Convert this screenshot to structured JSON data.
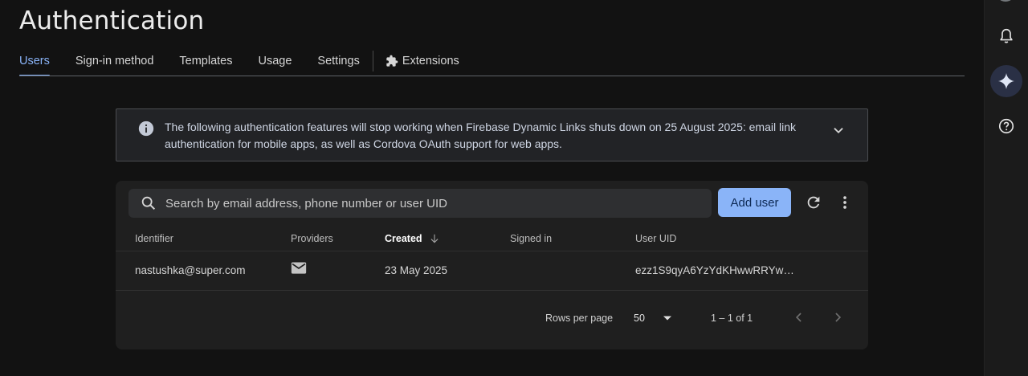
{
  "header": {
    "title": "Authentication"
  },
  "tabs": [
    {
      "label": "Users",
      "active": true
    },
    {
      "label": "Sign-in method"
    },
    {
      "label": "Templates"
    },
    {
      "label": "Usage"
    },
    {
      "label": "Settings"
    },
    {
      "label": "Extensions",
      "icon": "extensions-icon"
    }
  ],
  "banner": {
    "icon": "info-icon",
    "message": "The following authentication features will stop working when Firebase Dynamic Links shuts down on 25 August 2025: email link authentication for mobile apps, as well as Cordova OAuth support for web apps."
  },
  "users_table": {
    "search_placeholder": "Search by email address, phone number or user UID",
    "search_value": "",
    "add_user_label": "Add user",
    "columns": [
      "Identifier",
      "Providers",
      "Created",
      "Signed in",
      "User UID"
    ],
    "sorted_column": "Created",
    "rows": [
      {
        "identifier": "nastushka@super.com",
        "provider_icon": "email-icon",
        "created": "23 May 2025",
        "signed_in": "",
        "user_uid": "ezz1S9qyA6YzYdKHwwRRYw…"
      }
    ],
    "pagination": {
      "rows_per_page_label": "Rows per page",
      "rows_per_page_value": "50",
      "range": "1 – 1 of 1"
    }
  },
  "right_rail": [
    "notifications-bell-icon",
    "gemini-sparkle-icon",
    "help-icon"
  ],
  "colors": {
    "accent": "#8ab4f8",
    "background": "#121212",
    "card": "#1f1f1f"
  }
}
